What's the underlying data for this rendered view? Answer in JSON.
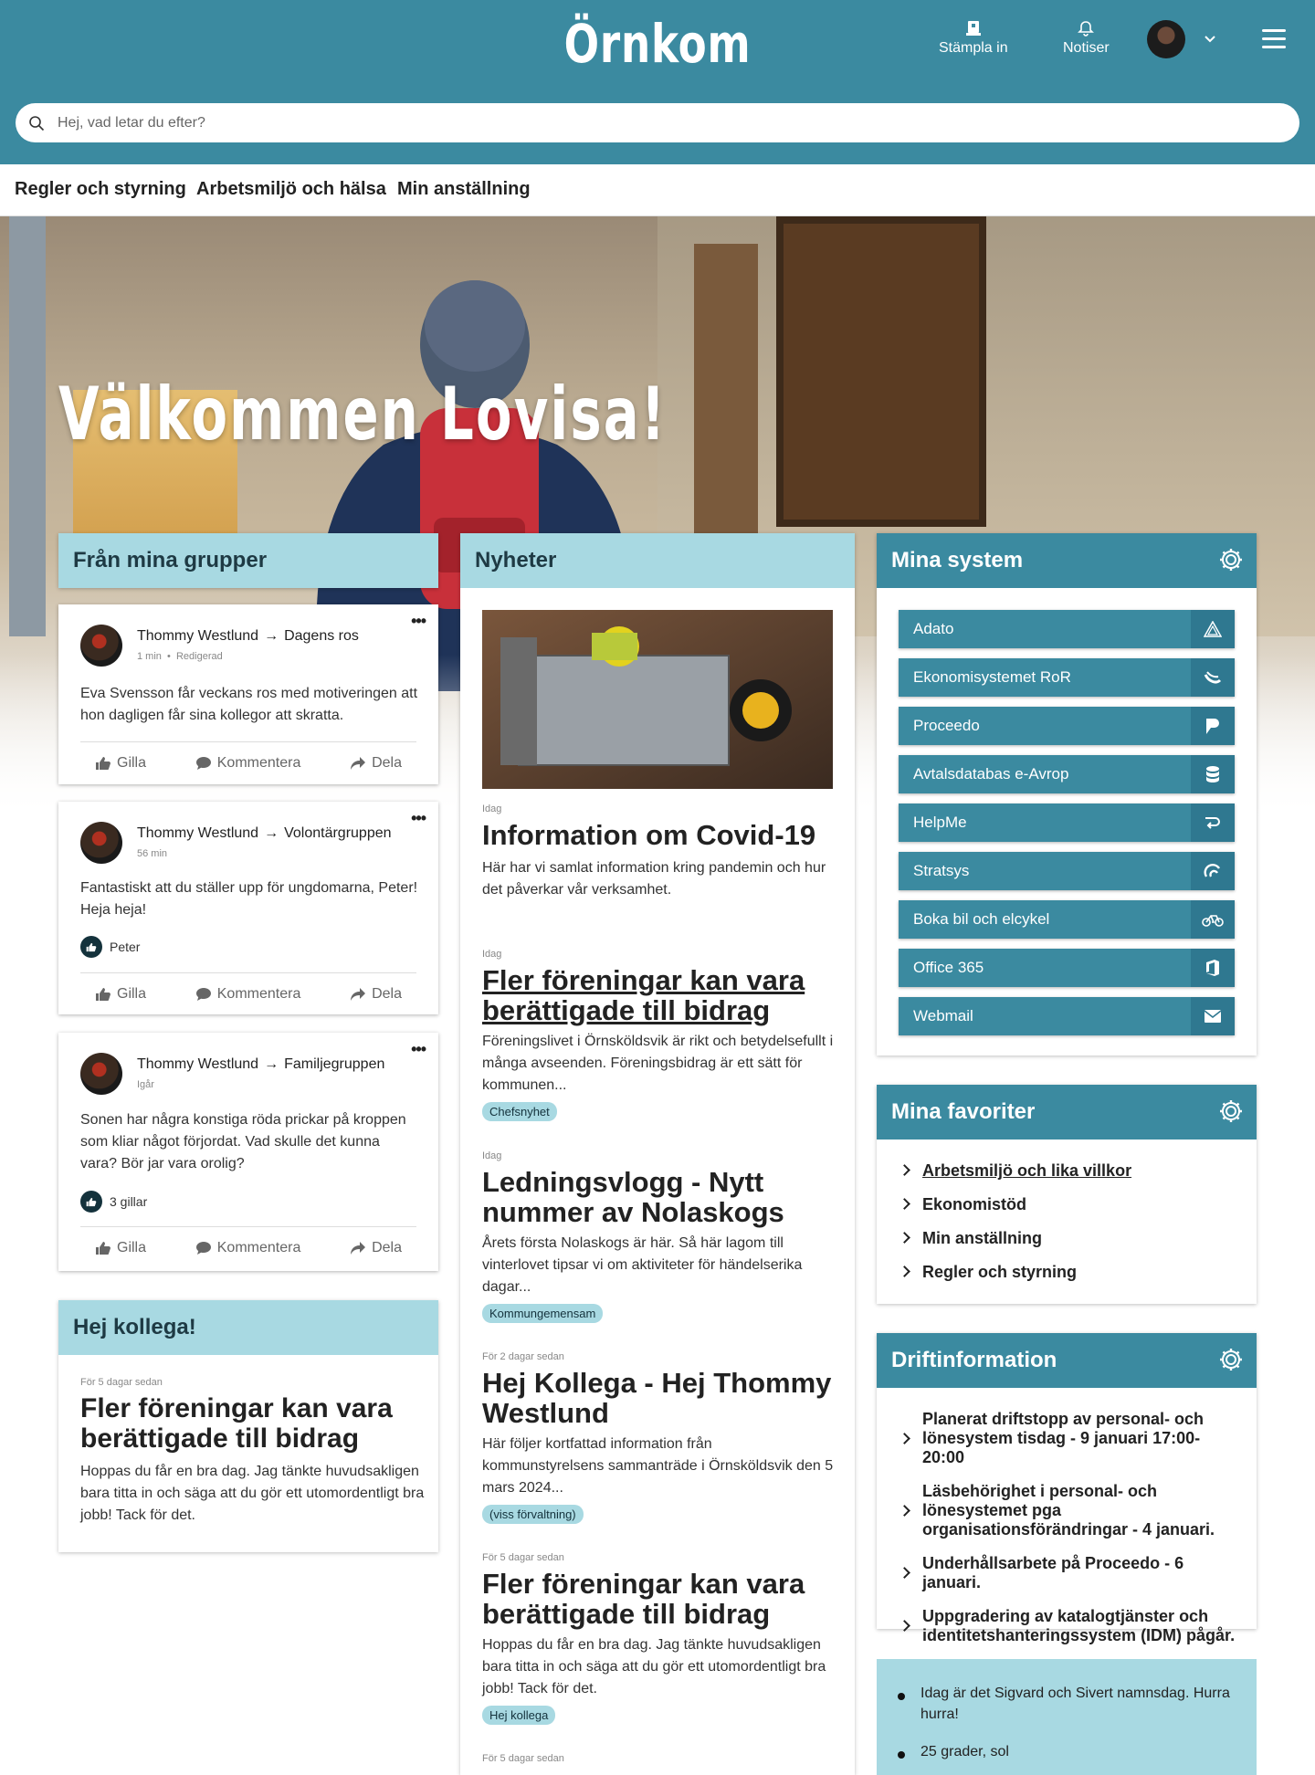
{
  "header": {
    "logo": "Örnkom",
    "stampla_label": "Stämpla in",
    "notiser_label": "Notiser",
    "search_placeholder": "Hej, vad letar du efter?"
  },
  "nav": [
    "Regler och styrning",
    "Arbetsmiljö och hälsa",
    "Min anställning"
  ],
  "hero": {
    "welcome": "Välkommen Lovisa!"
  },
  "groups": {
    "title": "Från mina grupper",
    "posts": [
      {
        "author": "Thommy Westlund",
        "group": "Dagens ros",
        "time": "1 min",
        "edited": "Redigerad",
        "text": "Eva Svensson får veckans ros med motiveringen att hon dagligen får sina kollegor att skratta.",
        "likes": ""
      },
      {
        "author": "Thommy Westlund",
        "group": "Volontärgruppen",
        "time": "56 min",
        "edited": "",
        "text": "Fantastiskt att du ställer upp för ungdomarna, Peter! Heja heja!",
        "likes": "Peter"
      },
      {
        "author": "Thommy Westlund",
        "group": "Familjegruppen",
        "time": "Igår",
        "edited": "",
        "text": "Sonen har några konstiga röda prickar på kroppen som kliar något förjordat. Vad skulle det kunna vara? Bör jar vara orolig?",
        "likes": "3 gillar"
      }
    ],
    "actions": {
      "like": "Gilla",
      "comment": "Kommentera",
      "share": "Dela"
    }
  },
  "hej_kollega": {
    "title": "Hej kollega!",
    "date": "För 5 dagar sedan",
    "headline": "Fler föreningar kan vara berättigade till bidrag",
    "text": "Hoppas du får en bra dag. Jag tänkte huvudsakligen bara titta in och säga att du gör ett utomordentligt bra jobb! Tack för det."
  },
  "news": {
    "title": "Nyheter",
    "items": [
      {
        "date": "Idag",
        "title": "Information om Covid-19",
        "excerpt": "Här har vi samlat information kring pandemin och hur det påverkar vår verksamhet.",
        "tag": ""
      },
      {
        "date": "Idag",
        "title": "Fler föreningar kan vara berättigade till bidrag",
        "excerpt": "Föreningslivet i Örnsköldsvik är rikt och betydelsefullt i många avseenden. Föreningsbidrag är ett sätt för kommunen...",
        "tag": "Chefsnyhet"
      },
      {
        "date": "Idag",
        "title": "Ledningsvlogg - Nytt nummer av Nolaskogs",
        "excerpt": "Årets första Nolaskogs är här. Så här lagom till vinterlovet tipsar vi om aktiviteter för händelserika dagar...",
        "tag": "Kommungemensam"
      },
      {
        "date": "För 2 dagar sedan",
        "title": "Hej Kollega - Hej Thommy Westlund",
        "excerpt": "Här följer kortfattad information från kommunstyrelsens sammanträde i Örnsköldsvik den 5 mars 2024...",
        "tag": "(viss förvaltning)"
      },
      {
        "date": "För 5 dagar sedan",
        "title": "Fler föreningar kan vara berättigade till bidrag",
        "excerpt": "Hoppas du får en bra dag. Jag tänkte huvudsakligen bara titta in och säga att du gör ett utomordentligt bra jobb! Tack för det.",
        "tag": "Hej kollega"
      },
      {
        "date": "För 5 dagar sedan",
        "title": "",
        "excerpt": "",
        "tag": ""
      }
    ]
  },
  "systems": {
    "title": "Mina system",
    "items": [
      {
        "label": "Adato",
        "icon": "adato-icon"
      },
      {
        "label": "Ekonomisystemet RoR",
        "icon": "ror-icon"
      },
      {
        "label": "Proceedo",
        "icon": "proceedo-icon"
      },
      {
        "label": "Avtalsdatabas e-Avrop",
        "icon": "database-icon"
      },
      {
        "label": "HelpMe",
        "icon": "helpme-icon"
      },
      {
        "label": "Stratsys",
        "icon": "stratsys-icon"
      },
      {
        "label": "Boka bil och elcykel",
        "icon": "bicycle-icon"
      },
      {
        "label": "Office 365",
        "icon": "office-icon"
      },
      {
        "label": "Webmail",
        "icon": "mail-icon"
      }
    ]
  },
  "favorites": {
    "title": "Mina favoriter",
    "items": [
      "Arbetsmiljö och lika villkor",
      "Ekonomistöd",
      "Min anställning",
      "Regler och styrning"
    ]
  },
  "drift": {
    "title": "Driftinformation",
    "items": [
      "Planerat driftstopp av personal- och lönesystem tisdag - 9 januari 17:00-20:00",
      "Läsbehörighet i personal- och lönesystemet pga organisationsförändringar - 4 januari.",
      "Underhållsarbete på Proceedo - 6 januari.",
      "Uppgradering av katalogtjänster och identitetshanteringssystem (IDM) pågår."
    ]
  },
  "info": {
    "items": [
      "Idag är det Sigvard och Sivert namnsdag. Hurra hurra!",
      "25 grader, sol"
    ]
  },
  "colors": {
    "primary": "#3b8aa0",
    "light": "#a8d9e2",
    "dark": "#14323c"
  }
}
